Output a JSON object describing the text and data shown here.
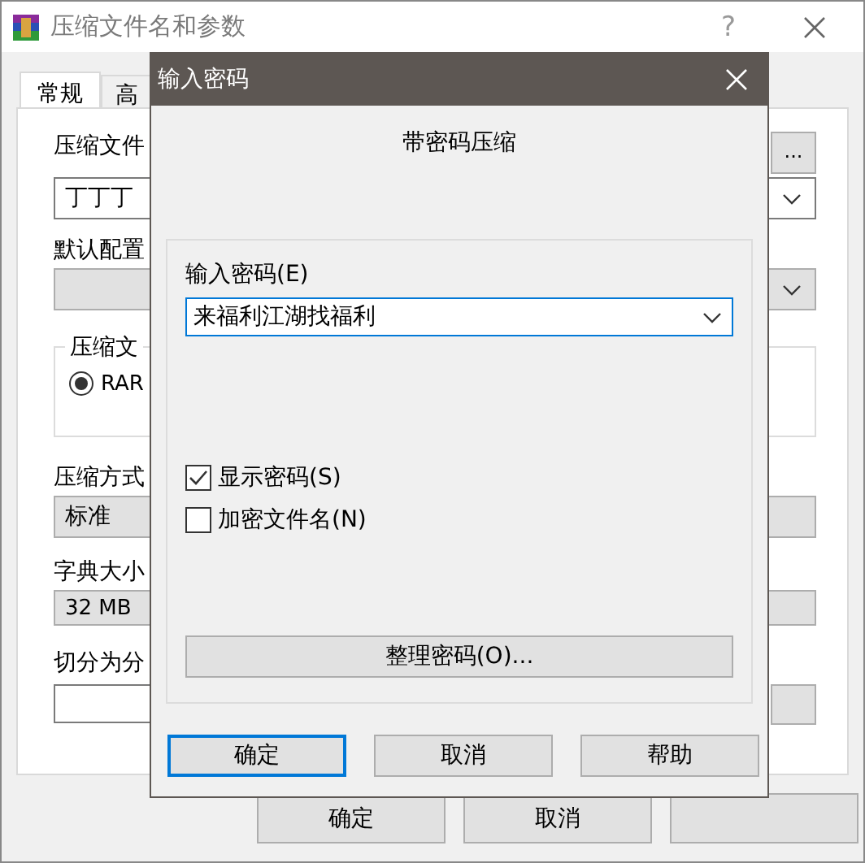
{
  "background_window": {
    "title": "压缩文件名和参数",
    "help": "?",
    "tabs": [
      {
        "label": "常规",
        "selected": true
      },
      {
        "label": "高",
        "selected": false
      }
    ],
    "archive_name_label": "压缩文件",
    "browse_button": "...",
    "archive_name_value": "丁丁丁",
    "profile_label": "默认配置",
    "format_group_label": "压缩文",
    "format_options": [
      {
        "label": "RAR",
        "selected": true
      }
    ],
    "method_label": "压缩方式",
    "method_value": "标准",
    "dictionary_label": "字典大小",
    "dictionary_value": "32 MB",
    "split_label": "切分为分",
    "buttons": [
      "确定",
      "取消"
    ]
  },
  "password_dialog": {
    "title": "输入密码",
    "heading": "带密码压缩",
    "password_label": "输入密码(E)",
    "password_value": "来福利江湖找福利",
    "options": [
      {
        "label": "显示密码(S)",
        "checked": true
      },
      {
        "label": "加密文件名(N)",
        "checked": false
      }
    ],
    "organize_button": "整理密码(O)...",
    "buttons": [
      {
        "label": "确定",
        "default": true
      },
      {
        "label": "取消",
        "default": false
      },
      {
        "label": "帮助",
        "default": false
      }
    ]
  }
}
